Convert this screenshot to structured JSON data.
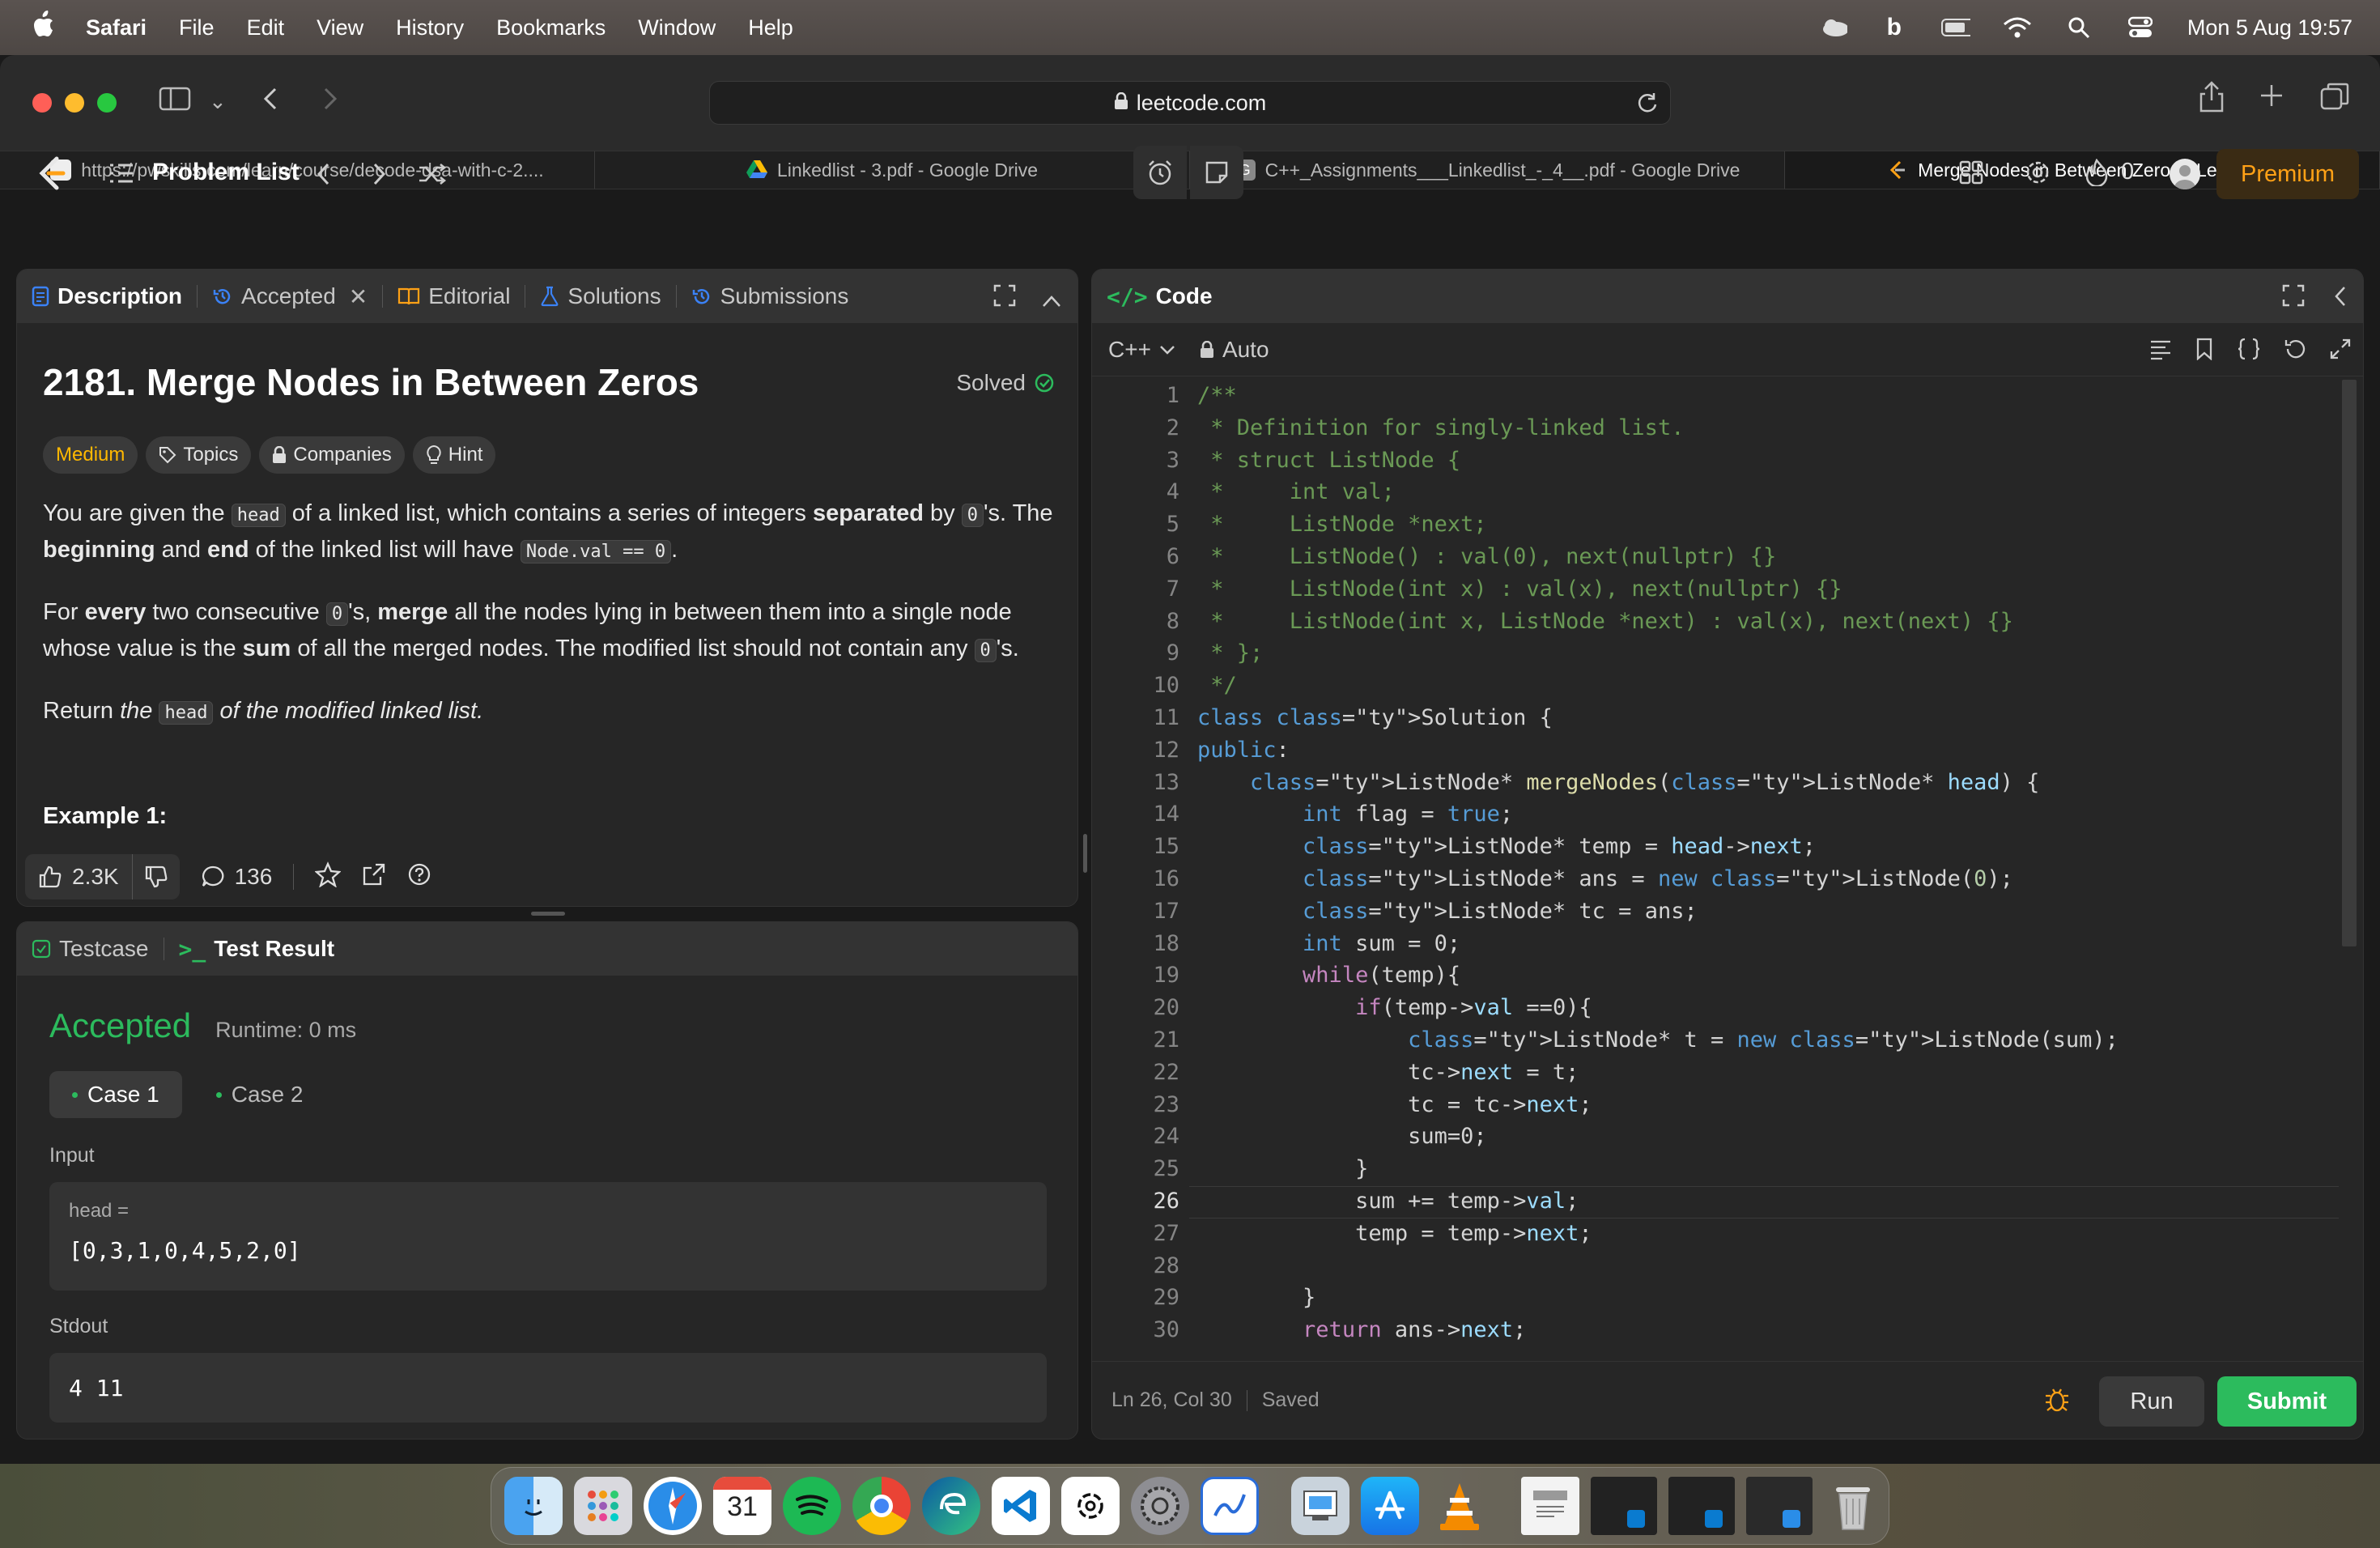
{
  "menubar": {
    "app": "Safari",
    "items": [
      "File",
      "Edit",
      "View",
      "History",
      "Bookmarks",
      "Window",
      "Help"
    ],
    "datetime": "Mon 5 Aug  19:57"
  },
  "browser": {
    "url": "leetcode.com",
    "tabs": [
      {
        "title": "https://pwskills.com/learn/course/decode-dsa-with-c-2....",
        "icon": "pwskills-icon"
      },
      {
        "title": "Linkedlist - 3.pdf - Google Drive",
        "icon": "google-drive-icon"
      },
      {
        "title": "C++_Assignments___Linkedlist_-_4__.pdf - Google Drive",
        "icon": "google-doc-icon"
      },
      {
        "title": "Merge Nodes in Between Zeros - LeetCode",
        "icon": "leetcode-icon",
        "active": true
      }
    ]
  },
  "lcnav": {
    "problem_list": "Problem List",
    "streak": "0",
    "premium": "Premium"
  },
  "left_tabs": {
    "description": "Description",
    "accepted": "Accepted",
    "editorial": "Editorial",
    "solutions": "Solutions",
    "submissions": "Submissions"
  },
  "problem": {
    "title": "2181. Merge Nodes in Between Zeros",
    "status": "Solved",
    "difficulty": "Medium",
    "chips": [
      "Topics",
      "Companies",
      "Hint"
    ],
    "p1_a": "You are given the ",
    "p1_code1": "head",
    "p1_b": " of a linked list, which contains a series of integers ",
    "p1_bold1": "separated",
    "p1_c": " by ",
    "p1_code2": "0",
    "p1_d": "'s. The ",
    "p1_bold2": "beginning",
    "p1_e": " and ",
    "p1_bold3": "end",
    "p1_f": " of the linked list will have ",
    "p1_code3": "Node.val == 0",
    "p1_g": ".",
    "p2_a": "For ",
    "p2_bold1": "every",
    "p2_b": " two consecutive ",
    "p2_code1": "0",
    "p2_c": "'s, ",
    "p2_bold2": "merge",
    "p2_d": " all the nodes lying in between them into a single node whose value is the ",
    "p2_bold3": "sum",
    "p2_e": " of all the merged nodes. The modified list should not contain any ",
    "p2_code2": "0",
    "p2_f": "'s.",
    "p3_a": "Return ",
    "p3_b": "the ",
    "p3_code": "head",
    "p3_c": " of the modified linked list.",
    "example_heading": "Example 1:",
    "likes": "2.3K",
    "comments": "136"
  },
  "result": {
    "testcase_tab": "Testcase",
    "result_tab": "Test Result",
    "verdict": "Accepted",
    "runtime": "Runtime: 0 ms",
    "cases": [
      "Case 1",
      "Case 2"
    ],
    "input_label": "Input",
    "input_var": "head =",
    "input_value": "[0,3,1,0,4,5,2,0]",
    "stdout_label": "Stdout",
    "stdout_value": "4 11"
  },
  "editor": {
    "title": "Code",
    "language": "C++",
    "mode": "Auto",
    "status_pos": "Ln 26, Col 30",
    "status_saved": "Saved",
    "run": "Run",
    "submit": "Submit",
    "current_line": 26,
    "lines": [
      "/**",
      " * Definition for singly-linked list.",
      " * struct ListNode {",
      " *     int val;",
      " *     ListNode *next;",
      " *     ListNode() : val(0), next(nullptr) {}",
      " *     ListNode(int x) : val(x), next(nullptr) {}",
      " *     ListNode(int x, ListNode *next) : val(x), next(next) {}",
      " * };",
      " */",
      "class Solution {",
      "public:",
      "    ListNode* mergeNodes(ListNode* head) {",
      "        int flag = true;",
      "        ListNode* temp = head->next;",
      "        ListNode* ans = new ListNode(0);",
      "        ListNode* tc = ans;",
      "        int sum = 0;",
      "        while(temp){",
      "            if(temp->val ==0){",
      "                ListNode* t = new ListNode(sum);",
      "                tc->next = t;",
      "                tc = tc->next;",
      "                sum=0;",
      "            }",
      "            sum += temp->val;",
      "            temp = temp->next;",
      "",
      "        }",
      "        return ans->next;"
    ]
  },
  "dock": [
    "finder-icon",
    "launchpad-icon",
    "safari-icon",
    "calendar-icon",
    "spotify-icon",
    "chrome-icon",
    "edge-icon",
    "vscode-icon",
    "chatgpt-icon",
    "settings-icon",
    "freeform-icon",
    "preview-icon",
    "appstore-icon",
    "vlc-icon",
    "document-icon",
    "window-thumb-icon",
    "window-thumb-icon",
    "window-thumb-icon",
    "trash-icon"
  ],
  "dock_calendar_day": "31"
}
